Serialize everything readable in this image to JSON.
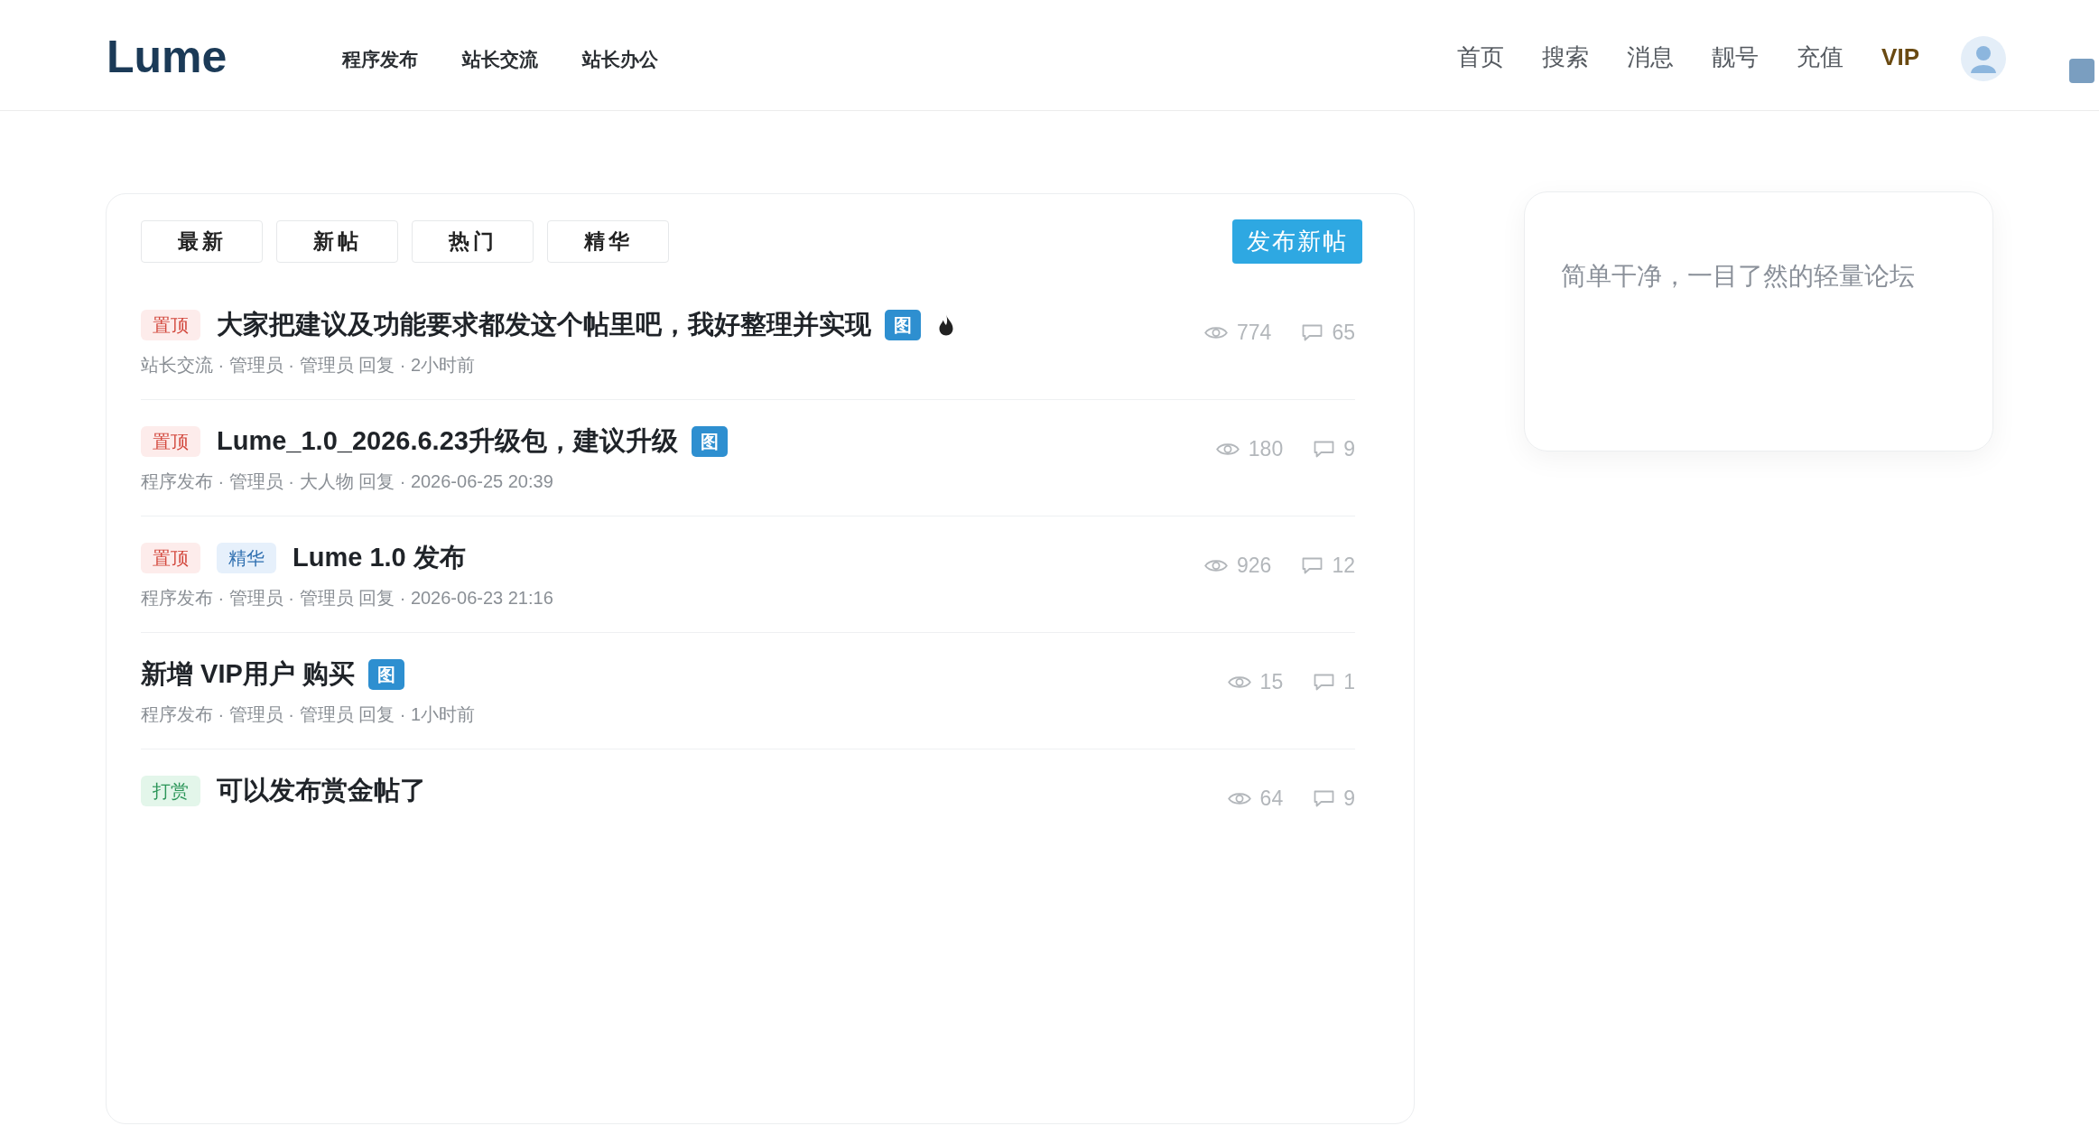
{
  "header": {
    "logo": "Lume",
    "nav": [
      "程序发布",
      "站长交流",
      "站长办公"
    ],
    "links": [
      {
        "label": "首页",
        "kind": "link"
      },
      {
        "label": "搜索",
        "kind": "link"
      },
      {
        "label": "消息",
        "kind": "link"
      },
      {
        "label": "靓号",
        "kind": "link"
      },
      {
        "label": "充值",
        "kind": "link"
      },
      {
        "label": "VIP",
        "kind": "vip"
      }
    ]
  },
  "tabs": [
    {
      "label": "最新",
      "selected": false
    },
    {
      "label": "新帖",
      "selected": false
    },
    {
      "label": "热门",
      "selected": false
    },
    {
      "label": "精华",
      "selected": false
    }
  ],
  "publish_button": "发布新帖",
  "posts": [
    {
      "tags": [
        {
          "label": "置顶",
          "kind": "pinned"
        }
      ],
      "title": "大家把建议及功能要求都发这个帖里吧，我好整理并实现",
      "badge": "图",
      "hot": true,
      "meta": "站长交流 · 管理员 · 管理员 回复 · 2小时前",
      "views": "774",
      "replies": "65"
    },
    {
      "tags": [
        {
          "label": "置顶",
          "kind": "pinned"
        }
      ],
      "title": "Lume_1.0_2026.6.23升级包，建议升级",
      "badge": "图",
      "hot": false,
      "meta": "程序发布 · 管理员 · 大人物 回复 · 2026-06-25 20:39",
      "views": "180",
      "replies": "9"
    },
    {
      "tags": [
        {
          "label": "置顶",
          "kind": "pinned"
        },
        {
          "label": "精华",
          "kind": "featured"
        }
      ],
      "title": "Lume 1.0 发布",
      "hot": false,
      "meta": "程序发布 · 管理员 · 管理员 回复 · 2026-06-23 21:16",
      "views": "926",
      "replies": "12"
    },
    {
      "title": "新增 VIP用户 购买",
      "badge": "图",
      "hot": false,
      "meta": "程序发布 · 管理员 · 管理员 回复 · 1小时前",
      "views": "15",
      "replies": "1"
    },
    {
      "tags": [
        {
          "label": "打赏",
          "kind": "reward"
        }
      ],
      "title": "可以发布赏金帖了",
      "hot": false,
      "views": "64",
      "replies": "9"
    }
  ],
  "sidebar": {
    "tagline": "简单干净，一目了然的轻量论坛"
  }
}
